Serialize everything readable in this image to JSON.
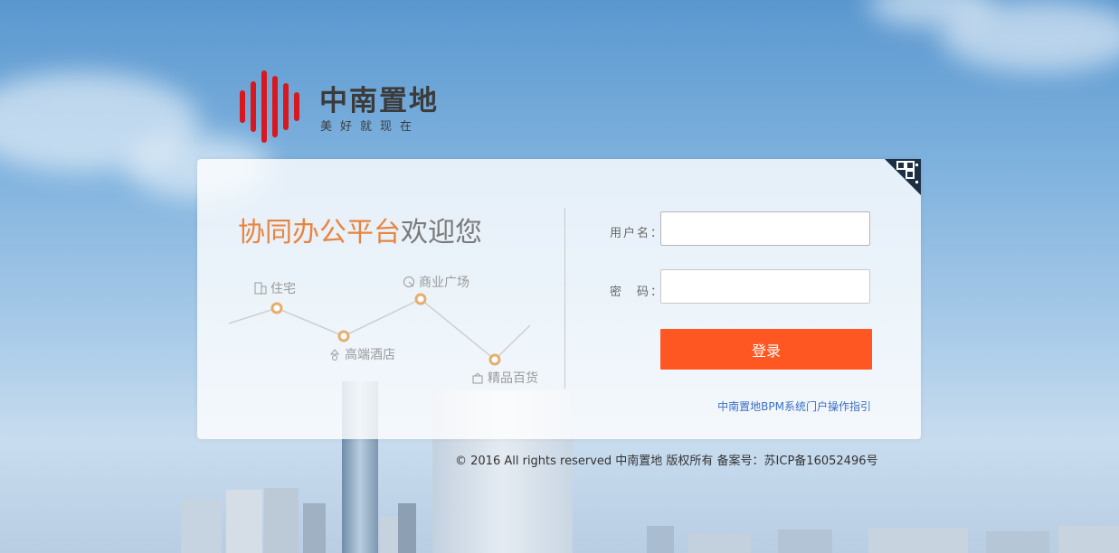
{
  "brand": {
    "name": "中南置地",
    "slogan": "美好就现在",
    "colors": {
      "logo_red": "#d7181f",
      "accent_orange": "#e9843f",
      "button": "#ff5722",
      "link": "#3a6fc4"
    }
  },
  "panel": {
    "welcome_highlight": "协同办公平台",
    "welcome_rest": "欢迎您",
    "qr_icon": "qr-code-icon",
    "graph_labels": {
      "residential": "住宅",
      "hotel": "高端酒店",
      "commercial": "商业广场",
      "retail": "精品百货"
    }
  },
  "form": {
    "username_label": "用户名：",
    "username_value": "",
    "password_label": "密　码：",
    "password_value": "",
    "login_button": "登录",
    "guide_link": "中南置地BPM系统门户操作指引"
  },
  "footer": {
    "text": "© 2016 All rights reserved 中南置地 版权所有  备案号：苏ICP备16052496号"
  }
}
